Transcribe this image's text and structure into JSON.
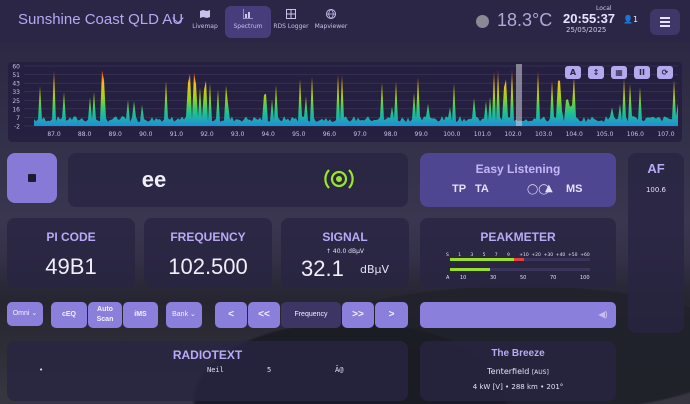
{
  "header": {
    "station_location": "Sunshine Coast QLD AU",
    "nav": [
      {
        "label": "Livemap",
        "icon": "map-icon"
      },
      {
        "label": "Spectrum",
        "icon": "chart-icon"
      },
      {
        "label": "RDS Logger",
        "icon": "table-icon"
      },
      {
        "label": "Mapviewer",
        "icon": "globe-icon"
      }
    ],
    "temperature": "18.3°C",
    "local_label": "Local",
    "time": "20:55:37",
    "date": "25/05/2025",
    "user_count": "1"
  },
  "spectrum": {
    "y_ticks": [
      "60",
      "51",
      "43",
      "33",
      "25",
      "16",
      "7",
      "-2"
    ],
    "x_ticks": [
      "87.0",
      "88.0",
      "89.0",
      "90.0",
      "91.0",
      "92.0",
      "93.0",
      "94.0",
      "95.0",
      "96.0",
      "97.0",
      "98.0",
      "99.0",
      "100.0",
      "101.0",
      "102.0",
      "103.0",
      "104.0",
      "105.0",
      "106.0",
      "107.0"
    ],
    "buttons": [
      "A",
      "↕",
      "▦",
      "II",
      "⟳"
    ]
  },
  "station": {
    "ps": "ee",
    "pty": "Easy Listening",
    "tp": "TP",
    "ta": "TA",
    "ms": "MS",
    "af_title": "AF",
    "af_list": [
      "100.6"
    ]
  },
  "readouts": {
    "pi_label": "PI CODE",
    "pi_value": "49B1",
    "freq_label": "FREQUENCY",
    "freq_value": "102.500",
    "signal_label": "SIGNAL",
    "signal_peak": "↑ 40.0 dBµV",
    "signal_value": "32.1",
    "signal_unit": "dBµV",
    "peakmeter_label": "PEAKMETER",
    "peak_scale_top": [
      "S",
      "1",
      "3",
      "5",
      "7",
      "9",
      "+10",
      "+20",
      "+30",
      "+40",
      "+50",
      "+60"
    ],
    "peak_scale_bottom": [
      "A",
      "10",
      "30",
      "50",
      "70",
      "100"
    ]
  },
  "controls": {
    "antenna": "Omni",
    "ceq": "cEQ",
    "autoscan": "Auto Scan",
    "ims": "iMS",
    "bank": "Bank",
    "step_back": "<",
    "fast_back": "<<",
    "step_mode": "Frequency",
    "fast_fwd": ">>",
    "step_fwd": ">"
  },
  "radiotext": {
    "title": "RADIOTEXT",
    "line": [
      "•",
      "Neil",
      "5",
      "Ã@"
    ]
  },
  "tx": {
    "name": "The Breeze",
    "city": "Tenterfield",
    "country": "[AUS]",
    "details": "4 kW [V] • 288 km • 201°"
  }
}
